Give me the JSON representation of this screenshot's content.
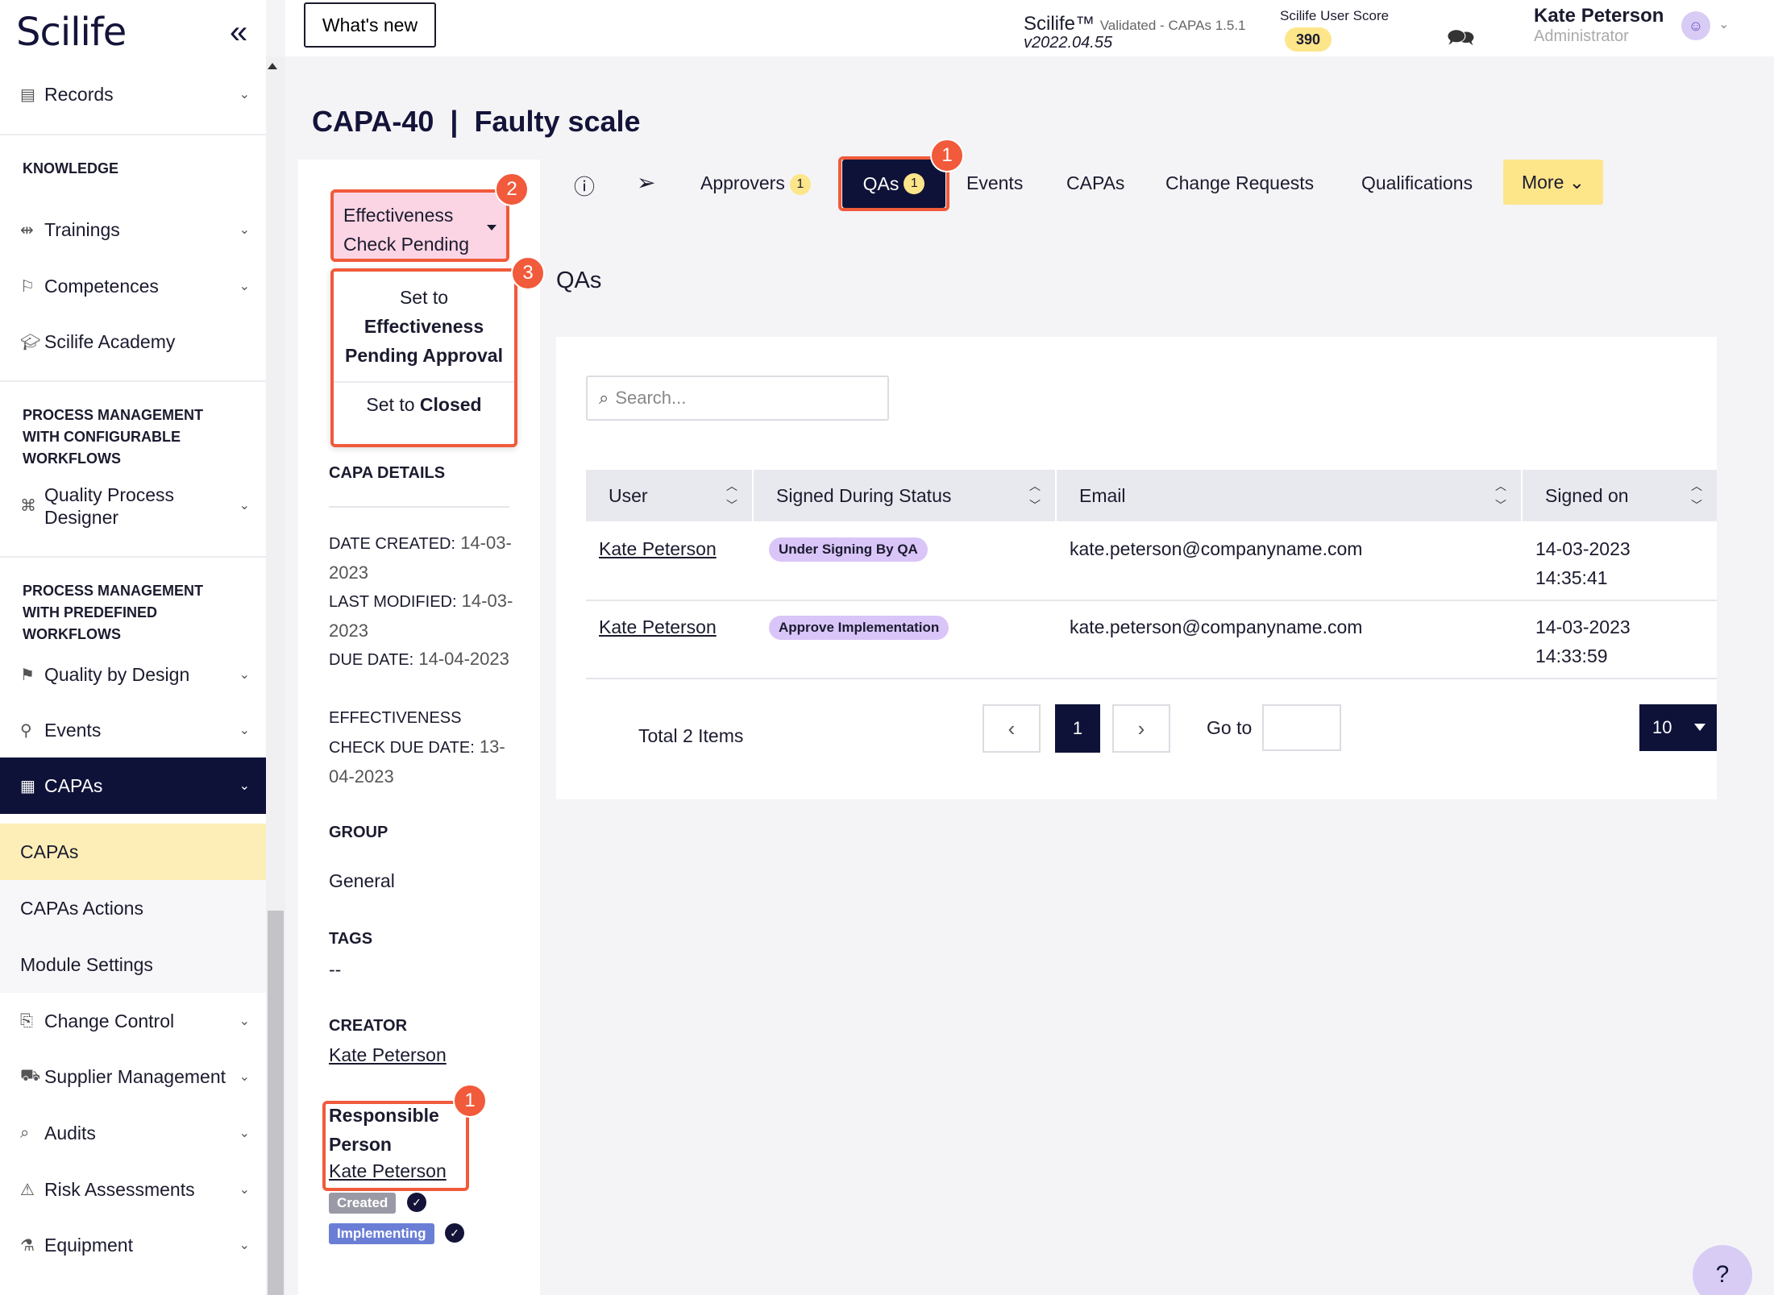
{
  "sidebar": {
    "logo": "Scilife",
    "items": {
      "records": "Records",
      "trainings": "Trainings",
      "competences": "Competences",
      "academy": "Scilife Academy",
      "qpd": "Quality Process Designer",
      "qbd": "Quality by Design",
      "events": "Events",
      "capas": "CAPAs",
      "change_control": "Change Control",
      "supplier": "Supplier Management",
      "audits": "Audits",
      "risk": "Risk Assessments",
      "equipment": "Equipment"
    },
    "sections": {
      "knowledge": "KNOWLEDGE",
      "configurable": "PROCESS MANAGEMENT WITH CONFIGURABLE WORKFLOWS",
      "predefined": "PROCESS MANAGEMENT WITH PREDEFINED WORKFLOWS"
    },
    "subitems": {
      "capas": "CAPAs",
      "actions": "CAPAs Actions",
      "settings": "Module Settings"
    }
  },
  "header": {
    "whats_new": "What's new",
    "brand": "Scilife™",
    "validated": "Validated - CAPAs 1.5.1",
    "version": "v2022.04.55",
    "score_label": "Scilife User Score",
    "score": "390",
    "user_name": "Kate Peterson",
    "user_role": "Administrator"
  },
  "page": {
    "title": "CAPA-40  |  Faulty scale"
  },
  "status": {
    "current": "Effectiveness Check Pending",
    "menu_opt1_prefix": "Set to",
    "menu_opt1_bold": "Effectiveness Pending Approval",
    "menu_opt2_prefix": "Set to",
    "menu_opt2_bold": "Closed"
  },
  "callouts": {
    "n1": "1",
    "n2": "2",
    "n3": "3"
  },
  "details": {
    "heading": "CAPA DETAILS",
    "date_created_label": "DATE CREATED:",
    "date_created": "14-03-2023",
    "last_modified_label": "LAST MODIFIED:",
    "last_modified": "14-03-2023",
    "due_date_label": "DUE DATE:",
    "due_date": "14-04-2023",
    "eff_due_label": "EFFECTIVENESS CHECK DUE DATE:",
    "eff_due": "13-04-2023",
    "group_label": "GROUP",
    "group": "General",
    "tags_label": "TAGS",
    "tags": "--",
    "creator_label": "CREATOR",
    "creator": "Kate Peterson",
    "responsible_label": "Responsible Person",
    "responsible": "Kate Peterson",
    "chip_created": "Created",
    "chip_implementing": "Implementing"
  },
  "tabs": {
    "approvers": "Approvers",
    "approvers_count": "1",
    "qas": "QAs",
    "qas_count": "1",
    "events": "Events",
    "capas": "CAPAs",
    "change_requests": "Change Requests",
    "qualifications": "Qualifications",
    "more": "More"
  },
  "qas": {
    "title": "QAs",
    "search_placeholder": "Search...",
    "columns": [
      "User",
      "Signed During Status",
      "Email",
      "Signed on"
    ],
    "rows": [
      {
        "user": "Kate Peterson",
        "status": "Under Signing By QA",
        "email": "kate.peterson@companyname.com",
        "date": "14-03-2023",
        "time": "14:35:41"
      },
      {
        "user": "Kate Peterson",
        "status": "Approve Implementation",
        "email": "kate.peterson@companyname.com",
        "date": "14-03-2023",
        "time": "14:33:59"
      }
    ],
    "total": "Total 2 Items",
    "current_page": "1",
    "goto": "Go to",
    "per_page": "10"
  }
}
